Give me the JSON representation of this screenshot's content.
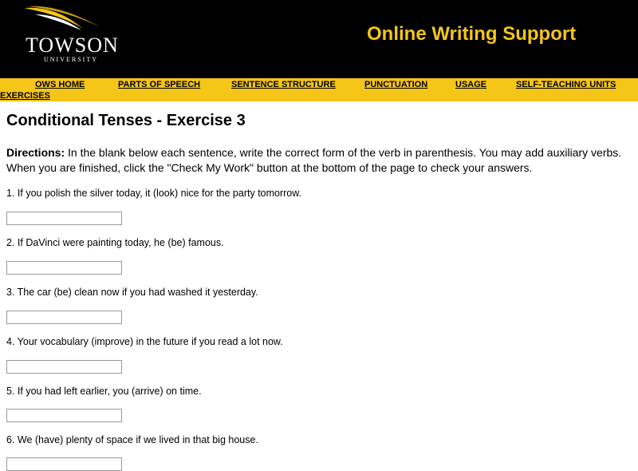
{
  "header": {
    "logo_name": "TOWSON",
    "logo_sub": "UNIVERSITY",
    "site_title": "Online Writing Support"
  },
  "nav": {
    "items": [
      "OWS HOME",
      "PARTS OF SPEECH",
      "SENTENCE STRUCTURE",
      "PUNCTUATION",
      "USAGE",
      "SELF-TEACHING UNITS",
      "EXERCISES"
    ]
  },
  "page": {
    "title": "Conditional Tenses - Exercise 3",
    "directions_label": "Directions:",
    "directions_text": " In the blank below each sentence, write the correct form of the verb in parenthesis. You may add auxiliary verbs. When you are finished, click the \"Check My Work\" button at the bottom of the page to check your answers."
  },
  "questions": [
    {
      "text": "1. If you polish the silver today, it (look) nice for the party tomorrow.",
      "answer": ""
    },
    {
      "text": "2. If DaVinci were painting today, he (be) famous.",
      "answer": ""
    },
    {
      "text": "3. The car (be) clean now if you had washed it yesterday.",
      "answer": ""
    },
    {
      "text": "4. Your vocabulary (improve) in the future if you read a lot now.",
      "answer": ""
    },
    {
      "text": "5. If you had left earlier, you (arrive) on time.",
      "answer": ""
    },
    {
      "text": "6. We (have) plenty of space if we lived in that big house.",
      "answer": ""
    }
  ]
}
